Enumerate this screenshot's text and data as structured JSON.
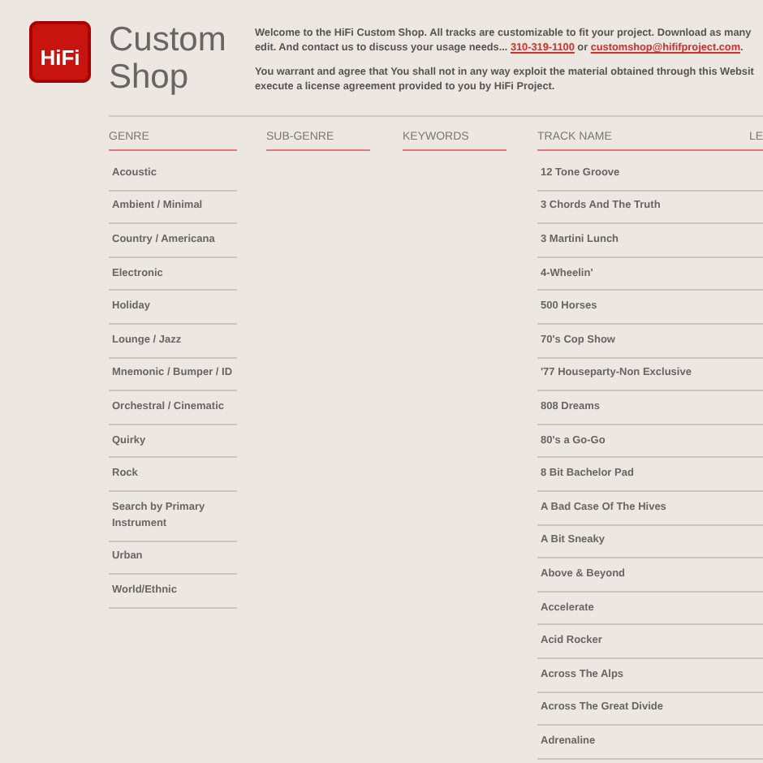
{
  "logo": {
    "text": "HiFi"
  },
  "title": [
    "Custom",
    "Shop"
  ],
  "intro": [
    {
      "lines": [
        [
          {
            "kind": "text",
            "text": "Welcome to the HiFi Custom Shop. All tracks are customizable to fit your project. Download as many"
          }
        ],
        [
          {
            "kind": "text",
            "text": "edit. And contact us to discuss your usage needs... "
          },
          {
            "kind": "link",
            "text": "310-319-1100"
          },
          {
            "kind": "text",
            "text": " or "
          },
          {
            "kind": "link",
            "text": "customshop@hififproject.com"
          },
          {
            "kind": "text",
            "text": "."
          }
        ]
      ]
    },
    {
      "lines": [
        [
          {
            "kind": "text",
            "text": "You warrant and agree that You shall not in any way exploit the material obtained through this Websit"
          }
        ],
        [
          {
            "kind": "text",
            "text": "execute a license agreement provided to you by HiFi Project."
          }
        ]
      ]
    }
  ],
  "columns": [
    {
      "kind": "genre",
      "heading": "GENRE",
      "items": [
        "Acoustic",
        "Ambient / Minimal",
        "Country / Americana",
        "Electronic",
        "Holiday",
        "Lounge / Jazz",
        "Mnemonic / Bumper / ID",
        "Orchestral / Cinematic",
        "Quirky",
        "Rock",
        "Search by Primary Instrument",
        "Urban",
        "World/Ethnic"
      ]
    },
    {
      "kind": "subgenre",
      "heading": "SUB-GENRE"
    },
    {
      "kind": "keywords",
      "heading": "KEYWORDS"
    },
    {
      "kind": "track",
      "heading": "TRACK NAME",
      "extra_heading": "LE",
      "items": [
        "12 Tone Groove",
        "3 Chords And The Truth",
        "3 Martini Lunch",
        "4-Wheelin'",
        "500 Horses",
        "70's Cop Show",
        "'77 Houseparty-Non Exclusive",
        "808 Dreams",
        "80's a Go-Go",
        "8 Bit Bachelor Pad",
        "A Bad Case Of The Hives",
        "A Bit Sneaky",
        "Above & Beyond",
        "Accelerate",
        "Acid Rocker",
        "Across The Alps",
        "Across The Great Divide",
        "Adrenaline"
      ]
    }
  ]
}
